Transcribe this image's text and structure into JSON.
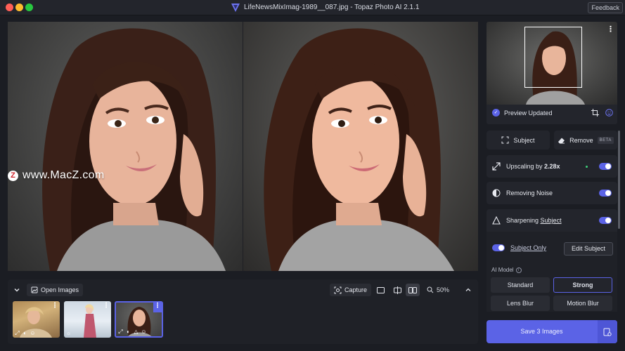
{
  "window": {
    "title": "LifeNewsMixImag-1989__087.jpg - Topaz Photo AI 2.1.1",
    "feedback_label": "Feedback"
  },
  "watermark": {
    "text": "www.MacZ.com"
  },
  "filmstrip": {
    "open_images_label": "Open Images",
    "capture_label": "Capture",
    "zoom_level": "50%",
    "thumbnails": [
      {
        "name": "thumb-1",
        "selected": false
      },
      {
        "name": "thumb-2",
        "selected": false
      },
      {
        "name": "thumb-3",
        "selected": true
      }
    ]
  },
  "navigator": {
    "status": "Preview Updated"
  },
  "panel": {
    "subject_label": "Subject",
    "remove_label": "Remove",
    "beta_badge": "BETA",
    "upscaling": {
      "prefix": "Upscaling by ",
      "value": "2.28x",
      "enabled": true
    },
    "noise": {
      "label": "Removing Noise",
      "enabled": true
    },
    "sharpening": {
      "prefix": "Sharpening ",
      "target": "Subject",
      "enabled": true,
      "subject_only_label": "Subject Only",
      "subject_only": true,
      "edit_subject_label": "Edit Subject",
      "ai_model_label": "AI Model",
      "models": [
        "Standard",
        "Strong",
        "Lens Blur",
        "Motion Blur"
      ],
      "selected_model": "Strong"
    }
  },
  "save": {
    "label": "Save 3 Images"
  },
  "colors": {
    "accent": "#5b63e6",
    "background": "#1b1d23",
    "card": "#23252c",
    "indicator_green": "#3ed07a"
  }
}
